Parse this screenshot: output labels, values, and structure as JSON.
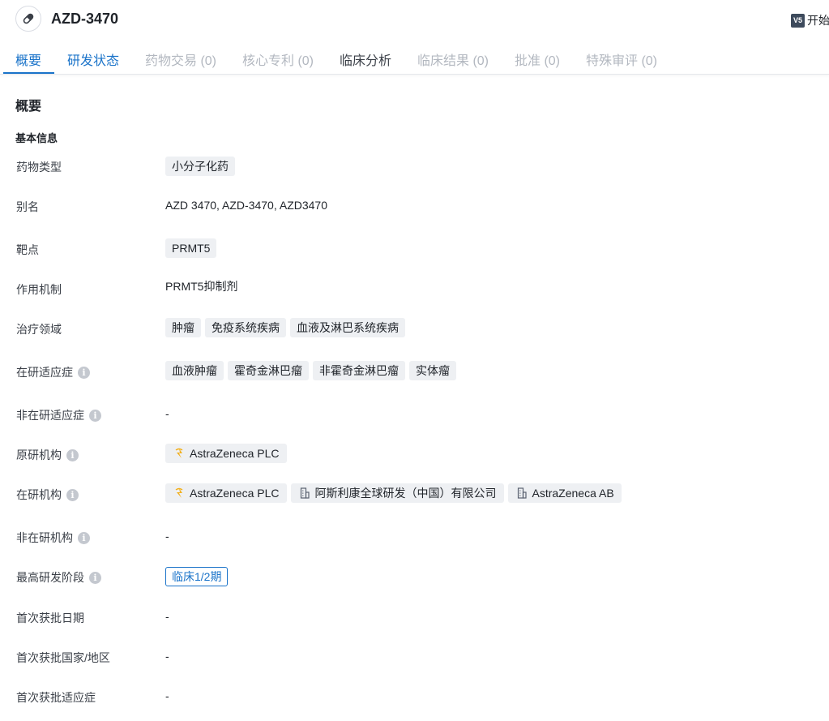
{
  "header": {
    "title": "AZD-3470",
    "version_badge": "V5",
    "start_label": "开始"
  },
  "tabs": [
    {
      "label": "概要",
      "state": "active"
    },
    {
      "label": "研发状态",
      "state": "blue"
    },
    {
      "label": "药物交易 (0)",
      "state": "disabled"
    },
    {
      "label": "核心专利 (0)",
      "state": "disabled"
    },
    {
      "label": "临床分析",
      "state": "dark"
    },
    {
      "label": "临床结果 (0)",
      "state": "disabled"
    },
    {
      "label": "批准 (0)",
      "state": "disabled"
    },
    {
      "label": "特殊审评 (0)",
      "state": "disabled"
    }
  ],
  "section_title": "概要",
  "sub_title": "基本信息",
  "rows": {
    "drug_type": {
      "label": "药物类型",
      "tags": [
        "小分子化药"
      ]
    },
    "alias": {
      "label": "别名",
      "value": "AZD 3470,  AZD-3470,  AZD3470"
    },
    "target": {
      "label": "靶点",
      "tags": [
        "PRMT5"
      ]
    },
    "mechanism": {
      "label": "作用机制",
      "value": "PRMT5抑制剂"
    },
    "therapeutic_area": {
      "label": "治疗领域",
      "tags": [
        "肿瘤",
        "免疫系统疾病",
        "血液及淋巴系统疾病"
      ]
    },
    "active_indications": {
      "label": "在研适应症",
      "tags": [
        "血液肿瘤",
        "霍奇金淋巴瘤",
        "非霍奇金淋巴瘤",
        "实体瘤"
      ]
    },
    "inactive_indications": {
      "label": "非在研适应症",
      "value": "-"
    },
    "originator": {
      "label": "原研机构",
      "orgs": [
        {
          "name": "AstraZeneca PLC",
          "icon": "astrazeneca-logo-icon"
        }
      ]
    },
    "active_orgs": {
      "label": "在研机构",
      "orgs": [
        {
          "name": "AstraZeneca PLC",
          "icon": "astrazeneca-logo-icon"
        },
        {
          "name": "阿斯利康全球研发（中国）有限公司",
          "icon": "building-icon"
        },
        {
          "name": "AstraZeneca AB",
          "icon": "building-icon"
        }
      ]
    },
    "inactive_orgs": {
      "label": "非在研机构",
      "value": "-"
    },
    "highest_phase": {
      "label": "最高研发阶段",
      "value": "临床1/2期"
    },
    "first_approval_date": {
      "label": "首次获批日期",
      "value": "-"
    },
    "first_approval_country": {
      "label": "首次获批国家/地区",
      "value": "-"
    },
    "first_approval_indication": {
      "label": "首次获批适应症",
      "value": "-"
    }
  },
  "colors": {
    "accent": "#1a73c9",
    "tag_bg": "#eef0f3",
    "disabled_tab": "#b3b8c0",
    "info_icon": "#c4c8cf"
  }
}
